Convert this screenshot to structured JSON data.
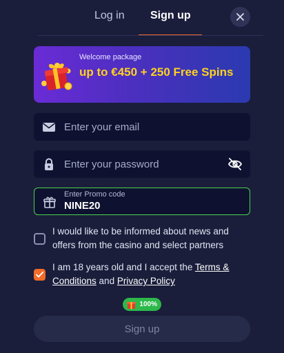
{
  "tabs": {
    "login": "Log in",
    "signup": "Sign up"
  },
  "banner": {
    "subtitle": "Welcome package",
    "headline": "up to €450 + 250 Free Spins"
  },
  "form": {
    "email_placeholder": "Enter your email",
    "password_placeholder": "Enter your password",
    "promo_label": "Enter Promo code",
    "promo_value": "NINE20"
  },
  "checkboxes": {
    "news": {
      "text": "I would like to be informed about news and offers from the casino and select partners",
      "checked": false
    },
    "age": {
      "text_before": "I am 18 years old and I accept the ",
      "terms_link": "Terms & Conditions",
      "text_middle": " and ",
      "privacy_link": "Privacy Policy",
      "checked": true
    }
  },
  "bonus_badge": "100%",
  "submit_label": "Sign up",
  "colors": {
    "accent": "#f26b2a",
    "promo_border": "#4bd44b",
    "banner_highlight": "#ffd21f",
    "background": "#1a1e3b"
  }
}
